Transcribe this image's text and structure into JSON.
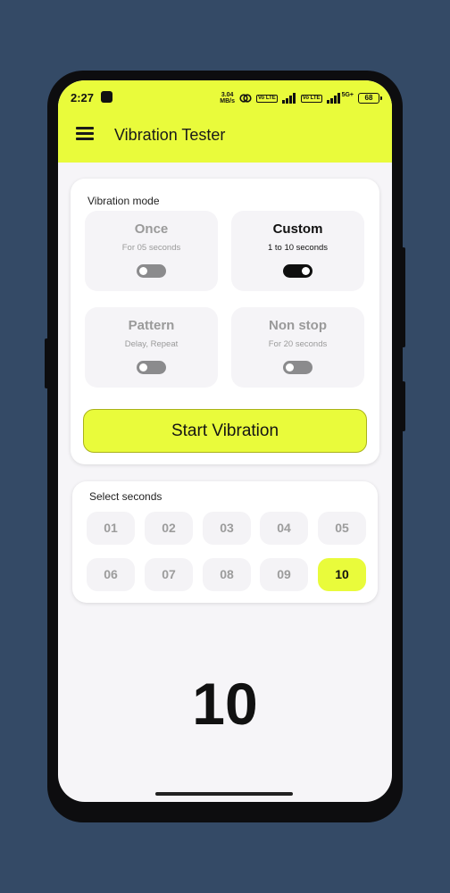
{
  "status_bar": {
    "time": "2:27",
    "net_speed_value": "3.04",
    "net_speed_unit": "MB/s",
    "volte_1": "Vo LTE",
    "volte_2": "Vo LTE",
    "signal_label": "5G+",
    "battery": "68"
  },
  "app_bar": {
    "title": "Vibration Tester",
    "menu_icon": "hamburger-menu-icon"
  },
  "vibration_mode": {
    "label": "Vibration mode",
    "modes": [
      {
        "name": "Once",
        "subtitle": "For 05 seconds",
        "enabled": false
      },
      {
        "name": "Custom",
        "subtitle": "1 to 10 seconds",
        "enabled": true
      },
      {
        "name": "Pattern",
        "subtitle": "Delay, Repeat",
        "enabled": false
      },
      {
        "name": "Non stop",
        "subtitle": "For 20 seconds",
        "enabled": false
      }
    ],
    "start_button": "Start Vibration"
  },
  "select_seconds": {
    "label": "Select seconds",
    "options": [
      "01",
      "02",
      "03",
      "04",
      "05",
      "06",
      "07",
      "08",
      "09",
      "10"
    ],
    "selected": "10"
  },
  "display_value": "10",
  "colors": {
    "accent": "#e9fb3b",
    "background": "#344a66",
    "screen": "#f6f5f8",
    "text": "#111111",
    "muted": "#9a9a9a"
  }
}
